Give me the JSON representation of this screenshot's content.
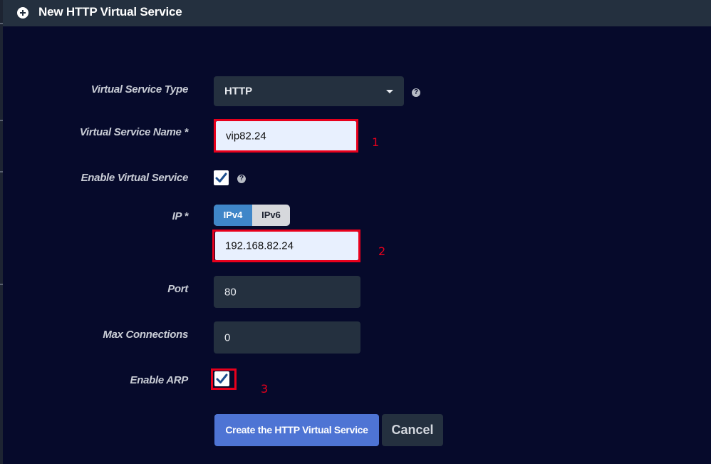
{
  "dialog": {
    "title": "New HTTP Virtual Service",
    "title_icon": "plus-circle-icon"
  },
  "form": {
    "virtual_service_type": {
      "label": "Virtual Service Type",
      "value": "HTTP",
      "help_icon": "question-circle-icon"
    },
    "virtual_service_name": {
      "label": "Virtual Service Name *",
      "value": "vip82.24"
    },
    "enable_virtual_service": {
      "label": "Enable Virtual Service",
      "checked": true,
      "help_icon": "question-circle-icon"
    },
    "ip": {
      "label": "IP *",
      "options": [
        "IPv4",
        "IPv6"
      ],
      "selected": "IPv4",
      "value": "192.168.82.24"
    },
    "port": {
      "label": "Port",
      "value": "80"
    },
    "max_connections": {
      "label": "Max Connections",
      "value": "0"
    },
    "enable_arp": {
      "label": "Enable ARP",
      "checked": true
    }
  },
  "buttons": {
    "create": "Create the HTTP Virtual Service",
    "cancel": "Cancel"
  },
  "annotations": [
    "1",
    "2",
    "3"
  ],
  "colors": {
    "background": "#060a2b",
    "panel": "#24303f",
    "accent_blue": "#3f86c8",
    "primary_button": "#4e74d4",
    "annotation_red": "#e8001c"
  }
}
